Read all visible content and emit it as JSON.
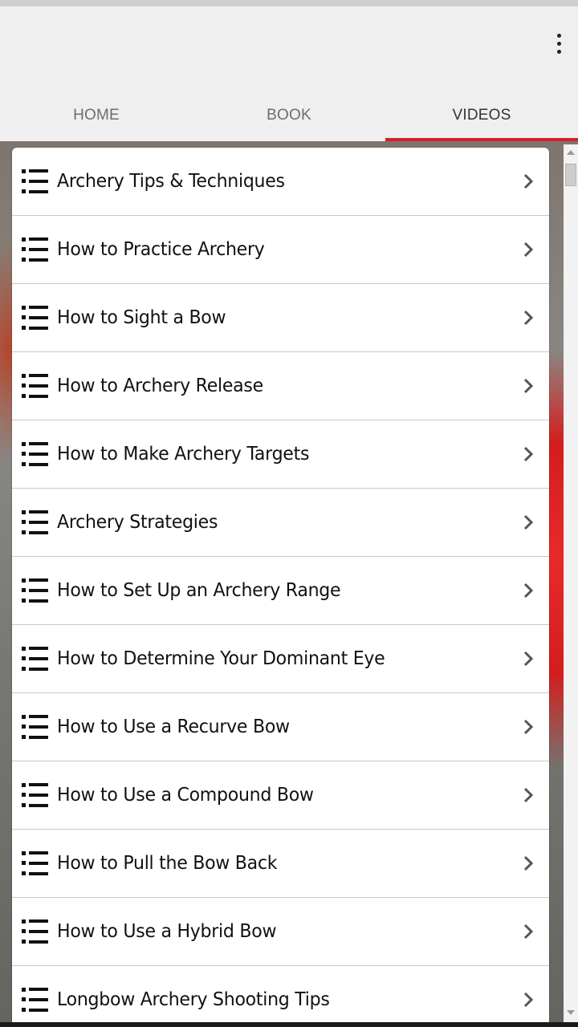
{
  "header": {
    "menu_icon": "more-vert-icon"
  },
  "tabs": [
    {
      "label": "HOME",
      "active": false
    },
    {
      "label": "BOOK",
      "active": false
    },
    {
      "label": "VIDEOS",
      "active": true
    }
  ],
  "colors": {
    "accent": "#d71f26",
    "tab_text": "#6d6d6d",
    "divider": "#c8c8c8"
  },
  "list": {
    "item_icon": "list-icon",
    "chevron_icon": "chevron-right-icon",
    "items": [
      {
        "label": "Archery Tips & Techniques"
      },
      {
        "label": "How to Practice Archery"
      },
      {
        "label": "How to Sight a Bow"
      },
      {
        "label": "How to Archery Release"
      },
      {
        "label": "How to Make Archery Targets"
      },
      {
        "label": "Archery Strategies"
      },
      {
        "label": "How to Set Up an Archery Range"
      },
      {
        "label": "How to Determine Your Dominant Eye"
      },
      {
        "label": "How to Use a Recurve Bow"
      },
      {
        "label": "How to Use a Compound Bow"
      },
      {
        "label": "How to Pull the Bow Back"
      },
      {
        "label": "How to Use a Hybrid Bow"
      },
      {
        "label": "Longbow Archery Shooting Tips"
      }
    ]
  },
  "scrollbar": {
    "up_icon": "scroll-up-arrow-icon",
    "down_icon": "scroll-down-arrow-icon"
  }
}
